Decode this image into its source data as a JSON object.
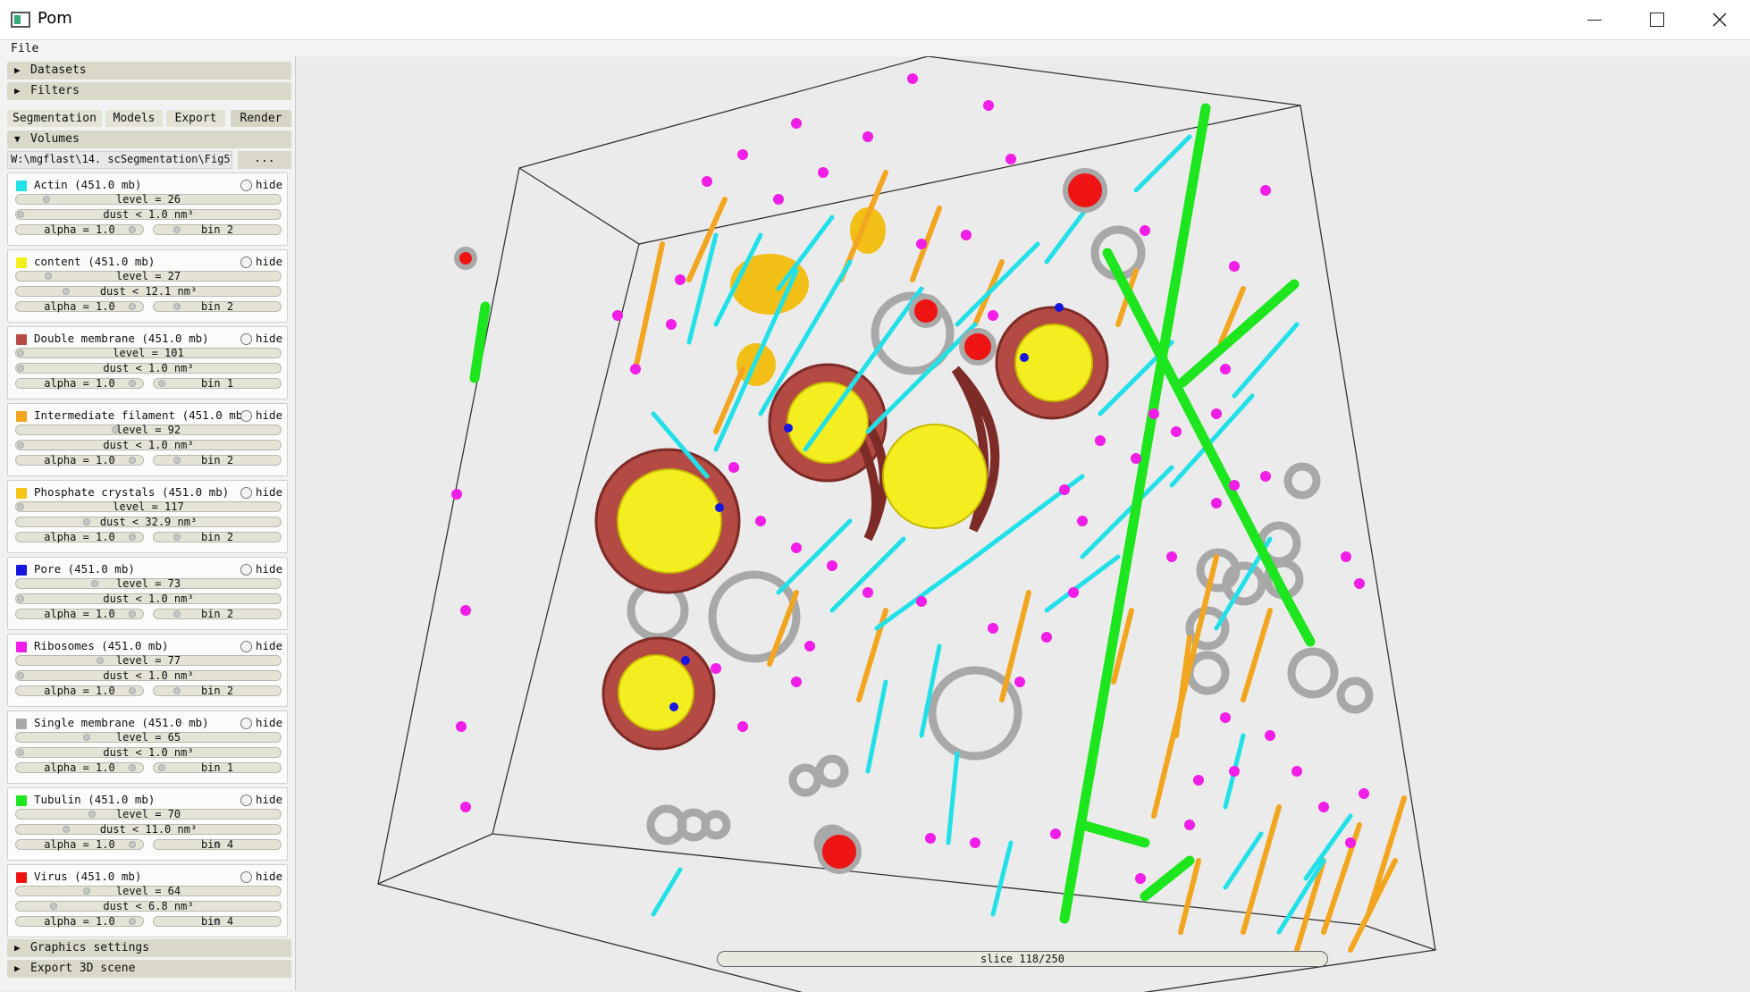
{
  "window": {
    "title": "Pom"
  },
  "menu": {
    "file": "File"
  },
  "panel": {
    "datasets": "Datasets",
    "filters": "Filters",
    "tabs": [
      "Segmentation",
      "Models",
      "Export",
      "Render"
    ],
    "active_tab": "Render",
    "volumes_header": "Volumes",
    "path": "W:\\mgflast\\14. scSegmentation\\Fig5\\",
    "browse": "...",
    "graphics_settings": "Graphics settings",
    "export_3d": "Export 3D scene",
    "arrows": {
      "collapsed": "▶",
      "expanded": "▼"
    },
    "volumes": [
      {
        "name": "Actin (451.0 mb)",
        "color": "#22e0e8",
        "hide": "hide",
        "level": "level = 26",
        "level_frac": 0.1,
        "dust": "dust < 1.0 nm³",
        "dust_frac": 0.0,
        "alpha": "alpha = 1.0",
        "bin": "bin 2",
        "bin_frac": 0.16
      },
      {
        "name": "content (451.0 mb)",
        "color": "#f2ee1a",
        "hide": "hide",
        "level": "level = 27",
        "level_frac": 0.11,
        "dust": "dust < 12.1 nm³",
        "dust_frac": 0.18,
        "alpha": "alpha = 1.0",
        "bin": "bin 2",
        "bin_frac": 0.16
      },
      {
        "name": "Double membrane (451.0 mb)",
        "color": "#b84a45",
        "hide": "hide",
        "level": "level = 101",
        "level_frac": 0.0,
        "dust": "dust < 1.0 nm³",
        "dust_frac": 0.0,
        "alpha": "alpha = 1.0",
        "bin": "bin 1",
        "bin_frac": 0.03
      },
      {
        "name": "Intermediate filament (451.0 mb)",
        "color": "#f2a51f",
        "hide": "hide",
        "level": "level = 92",
        "level_frac": 0.37,
        "dust": "dust < 1.0 nm³",
        "dust_frac": 0.0,
        "alpha": "alpha = 1.0",
        "bin": "bin 2",
        "bin_frac": 0.16
      },
      {
        "name": "Phosphate crystals (451.0 mb)",
        "color": "#f5c514",
        "hide": "hide",
        "level": "level = 117",
        "level_frac": 0.0,
        "dust": "dust < 32.9 nm³",
        "dust_frac": 0.26,
        "alpha": "alpha = 1.0",
        "bin": "bin 2",
        "bin_frac": 0.16
      },
      {
        "name": "Pore (451.0 mb)",
        "color": "#1616e0",
        "hide": "hide",
        "level": "level = 73",
        "level_frac": 0.29,
        "dust": "dust < 1.0 nm³",
        "dust_frac": 0.0,
        "alpha": "alpha = 1.0",
        "bin": "bin 2",
        "bin_frac": 0.16
      },
      {
        "name": "Ribosomes (451.0 mb)",
        "color": "#f01ee6",
        "hide": "hide",
        "level": "level = 77",
        "level_frac": 0.31,
        "dust": "dust < 1.0 nm³",
        "dust_frac": 0.0,
        "alpha": "alpha = 1.0",
        "bin": "bin 2",
        "bin_frac": 0.16
      },
      {
        "name": "Single membrane (451.0 mb)",
        "color": "#a9a9a9",
        "hide": "hide",
        "level": "level = 65",
        "level_frac": 0.26,
        "dust": "dust < 1.0 nm³",
        "dust_frac": 0.0,
        "alpha": "alpha = 1.0",
        "bin": "bin 1",
        "bin_frac": 0.03
      },
      {
        "name": "Tubulin (451.0 mb)",
        "color": "#1ee61e",
        "hide": "hide",
        "level": "level = 70",
        "level_frac": 0.28,
        "dust": "dust < 11.0 nm³",
        "dust_frac": 0.18,
        "alpha": "alpha = 1.0",
        "bin": "bin 4",
        "bin_frac": 0.5
      },
      {
        "name": "Virus (451.0 mb)",
        "color": "#ee1414",
        "hide": "hide",
        "level": "level = 64",
        "level_frac": 0.26,
        "dust": "dust < 6.8 nm³",
        "dust_frac": 0.13,
        "alpha": "alpha = 1.0",
        "bin": "bin 4",
        "bin_frac": 0.5
      }
    ]
  },
  "view": {
    "slice": "slice 118/250"
  }
}
